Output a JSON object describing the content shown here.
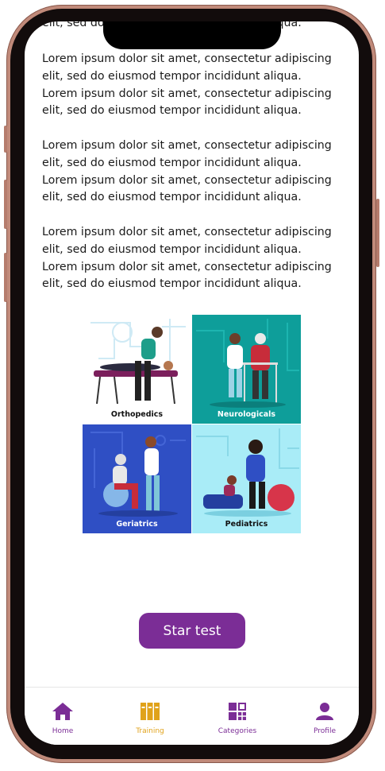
{
  "content": {
    "top_cut_text": "elit, sed do eiusmod tempor incididunt  aliqua.",
    "paragraphs": [
      "Lorem ipsum dolor sit amet, consectetur adipiscing\nelit, sed do eiusmod tempor incididunt  aliqua.\nLorem ipsum dolor sit amet, consectetur adipiscing\nelit, sed do eiusmod tempor incididunt  aliqua.",
      "Lorem ipsum dolor sit amet, consectetur adipiscing\nelit, sed do eiusmod tempor incididunt  aliqua.\nLorem ipsum dolor sit amet, consectetur adipiscing\nelit, sed do eiusmod tempor incididunt  aliqua.",
      "Lorem ipsum dolor sit amet, consectetur adipiscing\nelit, sed do eiusmod tempor incididunt  aliqua.\nLorem ipsum dolor sit amet, consectetur adipiscing\nelit, sed do eiusmod tempor incididunt  aliqua."
    ]
  },
  "categories_image": {
    "tiles": [
      {
        "label": "Orthopedics",
        "bg": "#ffffff",
        "label_color": "#111111"
      },
      {
        "label": "Neurologicals",
        "bg": "#0e9e9a",
        "label_color": "#ffffff"
      },
      {
        "label": "Geriatrics",
        "bg": "#2f4fc4",
        "label_color": "#ffffff"
      },
      {
        "label": "Pediatrics",
        "bg": "#a9ecf7",
        "label_color": "#111111"
      }
    ]
  },
  "action": {
    "start_label": "Star test",
    "color": "#7b2d96"
  },
  "nav": {
    "items": [
      {
        "label": "Home",
        "icon": "home-icon",
        "color": "#7b2d96"
      },
      {
        "label": "Training",
        "icon": "training-books-icon",
        "color": "#e0a21a"
      },
      {
        "label": "Categories",
        "icon": "categories-grid-icon",
        "color": "#7b2d96"
      },
      {
        "label": "Profile",
        "icon": "profile-icon",
        "color": "#7b2d96"
      }
    ]
  }
}
